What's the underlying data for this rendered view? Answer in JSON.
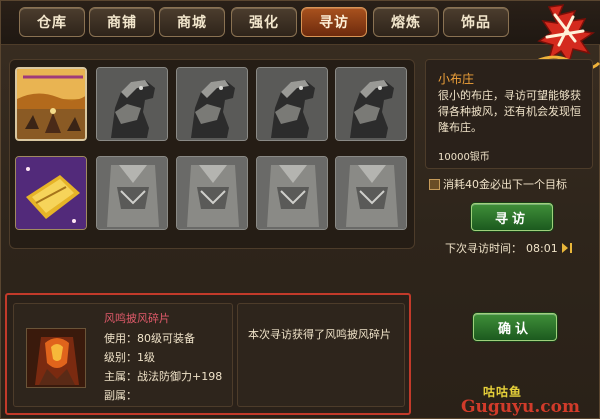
{
  "tabs": [
    {
      "label": "仓库",
      "active": false
    },
    {
      "label": "商铺",
      "active": false
    },
    {
      "label": "商城",
      "active": false
    },
    {
      "label": "强化",
      "active": false
    },
    {
      "label": "寻访",
      "active": true
    },
    {
      "label": "熔炼",
      "active": false
    },
    {
      "label": "饰品",
      "active": false
    }
  ],
  "logo": {
    "text": "战天"
  },
  "gallery": {
    "row1": [
      {
        "icon": "landscape-warriors-image",
        "selected": true
      },
      {
        "icon": "armored-horse-image"
      },
      {
        "icon": "armored-horse-image"
      },
      {
        "icon": "armored-horse-image"
      },
      {
        "icon": "armored-horse-image"
      }
    ],
    "row2": [
      {
        "icon": "golden-scroll-image"
      },
      {
        "icon": "cloak-image"
      },
      {
        "icon": "cloak-image"
      },
      {
        "icon": "cloak-image"
      },
      {
        "icon": "cloak-image"
      }
    ]
  },
  "info": {
    "title": "小布庄",
    "desc": "很小的布庄，寻访可望能够获得各种披风，还有机会发现恒隆布庄。",
    "price": "10000银币"
  },
  "option": {
    "label": "消耗40金必出下一个目标",
    "checked": false
  },
  "buttons": {
    "visit": "寻访",
    "confirm": "确认"
  },
  "next_visit": {
    "label": "下次寻访时间：",
    "time": "08:01"
  },
  "item": {
    "name": "风鸣披风碎片",
    "use": "使用：80级可装备",
    "level": "级别：1级",
    "main": "主属：战法防御力+198",
    "sub": "副属："
  },
  "message": "本次寻访获得了风鸣披风碎片",
  "watermark": {
    "cn": "咕咕鱼",
    "en": "Guguyu.com"
  },
  "colors": {
    "active_tab": "#a9521e",
    "green_button": "#3f8f39",
    "item_name": "#e05a6a",
    "info_title": "#f0a23a",
    "highlight_border": "#c23a2a"
  }
}
